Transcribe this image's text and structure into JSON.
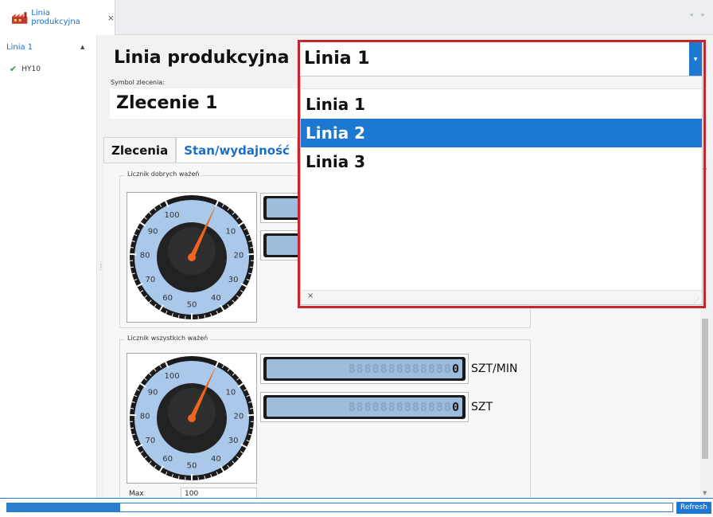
{
  "tabbar": {
    "document_tab_label": "Linia produkcyjna",
    "document_tab_icon": "factory-icon",
    "close_glyph": "×"
  },
  "tree": {
    "root_label": "Linia 1",
    "child_label": "HY10",
    "child_status_icon": "check-icon"
  },
  "main": {
    "production_line_label": "Linia produkcyjna",
    "order_symbol_label": "Symbol zlecenia:",
    "order_symbol_value": "Zlecenie 1",
    "tabs": [
      {
        "label": "Zlecenia",
        "active": false
      },
      {
        "label": "Stan/wydajność",
        "active": true
      }
    ]
  },
  "combo": {
    "selected_value": "Linia 1",
    "options": [
      "Linia 1",
      "Linia 2",
      "Linia 3"
    ],
    "highlighted_option": "Linia 2",
    "footer_close": "×"
  },
  "good_weighings": {
    "title": "Licznik dobrych ważeń",
    "gauge_ticks": [
      "10",
      "20",
      "30",
      "40",
      "50",
      "60",
      "70",
      "80",
      "90",
      "100"
    ],
    "gauge_value": 0
  },
  "all_weighings": {
    "title": "Licznik wszystkich ważeń",
    "gauge_ticks": [
      "10",
      "20",
      "30",
      "40",
      "50",
      "60",
      "70",
      "80",
      "90",
      "100"
    ],
    "gauge_value": 0,
    "rate_display": "0",
    "rate_unit": "SZT/MIN",
    "count_display": "0",
    "count_unit": "SZT",
    "max_label": "Max",
    "max_value": "100"
  },
  "statusbar": {
    "progress_fraction": 0.17,
    "refresh_label": "Refresh"
  },
  "colors": {
    "accent": "#1c78d1",
    "highlight_frame": "#c1272d",
    "gauge_face": "#a9c8ea",
    "needle": "#f0641e"
  }
}
